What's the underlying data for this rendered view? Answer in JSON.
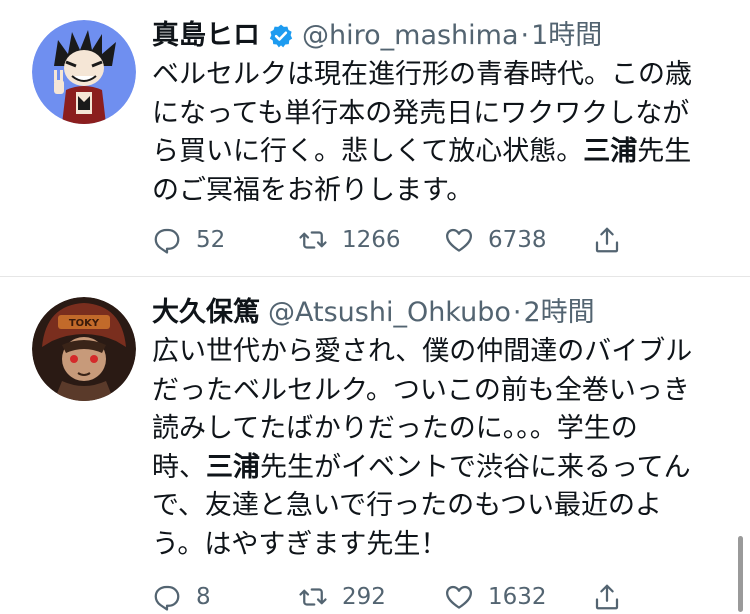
{
  "tweets": [
    {
      "author": {
        "display_name": "真島ヒロ",
        "handle": "@hiro_mashima",
        "verified": true
      },
      "separator": "·",
      "time": "1時間",
      "body_lines": [
        [
          "ベルセルクは現在進行形の青春時代。この歳"
        ],
        [
          "になっても単行本の発売日にワクワクしなが"
        ],
        [
          "ら買いに行く。悲しくて放心状態。",
          "三浦",
          "先生"
        ],
        [
          "のご冥福をお祈りします。"
        ]
      ],
      "reply_count": "52",
      "retweet_count": "1266",
      "like_count": "6738"
    },
    {
      "author": {
        "display_name": "大久保篤",
        "handle": "@Atsushi_Ohkubo",
        "verified": false
      },
      "separator": "·",
      "time": "2時間",
      "body_lines": [
        [
          "広い世代から愛され、僕の仲間達のバイブル"
        ],
        [
          "だったベルセルク。ついこの前も全巻いっき"
        ],
        [
          "読みしてたばかりだったのに。。。学生の"
        ],
        [
          "時、",
          "三浦",
          "先生がイベントで渋谷に来るってん"
        ],
        [
          "で、友達と急いで行ったのもつい最近のよ"
        ],
        [
          "う。はやすぎます先生！"
        ]
      ],
      "reply_count": "8",
      "retweet_count": "292",
      "like_count": "1632"
    }
  ],
  "icons": {
    "verified": "verified-badge-icon",
    "reply": "reply-icon",
    "retweet": "retweet-icon",
    "like": "heart-icon",
    "share": "share-icon"
  },
  "colors": {
    "text": "#0f1419",
    "muted": "#536471",
    "verified": "#1d9bf0",
    "divider": "#e6e6e6"
  }
}
